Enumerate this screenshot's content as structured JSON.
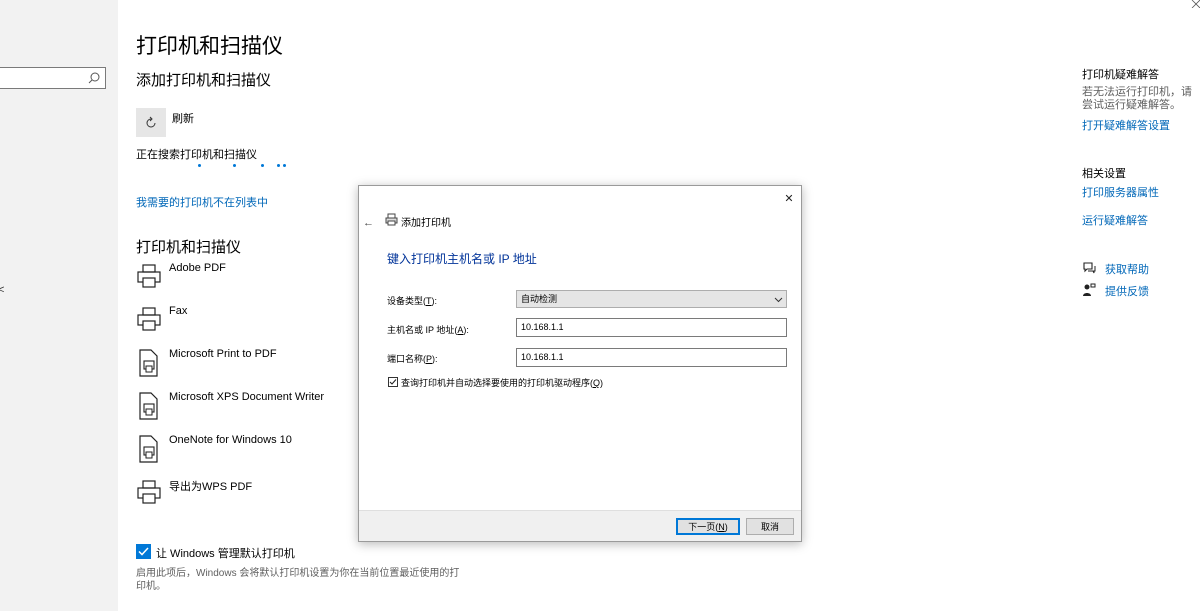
{
  "settings": {
    "page_title": "打印机和扫描仪",
    "add_heading": "添加打印机和扫描仪",
    "refresh_label": "刷新",
    "searching_label": "正在搜索打印机和扫描仪",
    "not_listed_link": "我需要的打印机不在列表中",
    "printers_heading": "打印机和扫描仪",
    "printers": [
      {
        "name": "Adobe PDF",
        "icon": "printer-icon"
      },
      {
        "name": "Fax",
        "icon": "printer-icon"
      },
      {
        "name": "Microsoft Print to PDF",
        "icon": "document-printer-icon"
      },
      {
        "name": "Microsoft XPS Document Writer",
        "icon": "document-printer-icon"
      },
      {
        "name": "OneNote for Windows 10",
        "icon": "document-printer-icon"
      },
      {
        "name": "导出为WPS PDF",
        "icon": "printer-icon"
      }
    ],
    "default_printer_label": "让 Windows 管理默认打印机",
    "default_printer_checked": true,
    "default_printer_desc": "启用此项后，Windows 会将默认打印机设置为你在当前位置最近使用的打印机。"
  },
  "left_nav": {
    "search_icon": "search-icon",
    "glyph": "<"
  },
  "right_column": {
    "troubleshoot_title": "打印机疑难解答",
    "troubleshoot_text": "若无法运行打印机，请尝试运行疑难解答。",
    "troubleshoot_link": "打开疑难解答设置",
    "related_title": "相关设置",
    "server_props_link": "打印服务器属性",
    "run_troubleshoot_link": "运行疑难解答",
    "get_help_link": "获取帮助",
    "feedback_link": "提供反馈"
  },
  "dialog": {
    "title": "添加打印机",
    "heading": "键入打印机主机名或 IP 地址",
    "device_type_label": "设备类型(",
    "device_type_key": "T",
    "device_type_value": "自动检测",
    "host_label": "主机名或 IP 地址(",
    "host_key": "A",
    "host_value": "10.168.1.1",
    "port_label": "端口名称(",
    "port_key": "P",
    "port_value": "10.168.1.1",
    "query_label": "查询打印机并自动选择要使用的打印机驱动程序(",
    "query_key": "Q",
    "query_checked": true,
    "next_button": "下一页(",
    "next_key": "N",
    "cancel_button": "取消",
    "close_symbol": "✕",
    "back_symbol": "←"
  },
  "colors": {
    "accent": "#0078d7",
    "link": "#0067b8",
    "dialog_heading": "#003399"
  }
}
